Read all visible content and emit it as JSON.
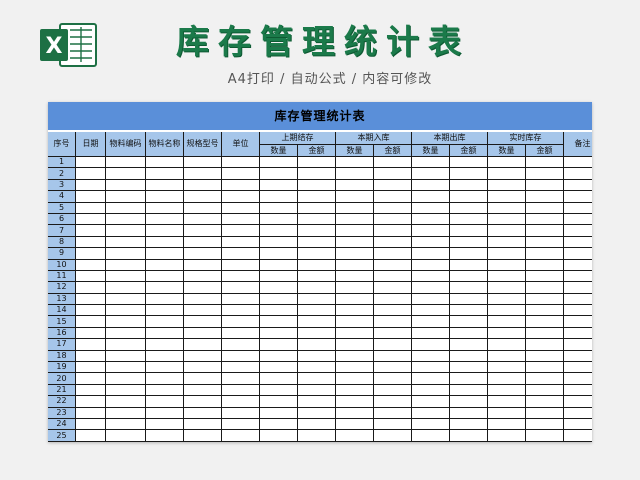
{
  "header": {
    "title": "库存管理统计表",
    "subtitle": "A4打印 / 自动公式 / 内容可修改",
    "icon": "excel-icon",
    "icon_letter": "X",
    "brand_color": "#1b7a4a"
  },
  "sheet": {
    "title": "库存管理统计表",
    "title_bg": "#5a8fd9",
    "header_bg": "#a6c6ea",
    "columns": {
      "seq": "序号",
      "date": "日期",
      "code": "物料编码",
      "name": "物料名称",
      "spec": "规格型号",
      "unit": "单位",
      "note": "备注"
    },
    "groups": [
      "上期结存",
      "本期入库",
      "本期出库",
      "实时库存"
    ],
    "sub": {
      "qty": "数量",
      "amount": "金额"
    },
    "rows": [
      "1",
      "2",
      "3",
      "4",
      "5",
      "6",
      "7",
      "8",
      "9",
      "10",
      "11",
      "12",
      "13",
      "14",
      "15",
      "16",
      "17",
      "18",
      "19",
      "20",
      "21",
      "22",
      "23",
      "24",
      "25"
    ]
  }
}
